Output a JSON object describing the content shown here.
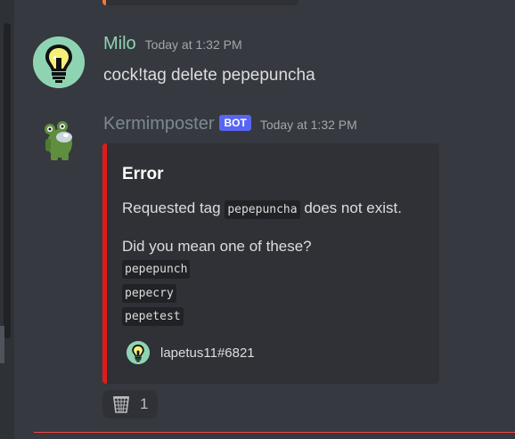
{
  "messages": [
    {
      "author": "Milo",
      "author_color": "#8fd4b2",
      "timestamp": "Today at 1:32 PM",
      "content": "cock!tag delete pepepuncha",
      "avatar_icon": "lightbulb-icon"
    },
    {
      "author": "Kermimposter",
      "author_color": "#7c8a90",
      "bot_tag": "BOT",
      "timestamp": "Today at 1:32 PM",
      "avatar_icon": "frog-crewmate-icon",
      "embed": {
        "accent": "#e01b1b",
        "title": "Error",
        "line1_prefix": "Requested tag ",
        "line1_code": "pepepuncha",
        "line1_suffix": " does not exist.",
        "line2": "Did you mean one of these?",
        "suggestions": [
          "pepepunch",
          "pepecry",
          "pepetest"
        ],
        "footer_text": "lapetus11#6821",
        "footer_icon": "lightbulb-icon"
      },
      "reaction": {
        "emoji": "wastebasket-icon",
        "count": "1"
      }
    }
  ],
  "colors": {
    "background": "#36393f",
    "embed_background": "#2f3136",
    "bot_tag": "#5865f2",
    "new_messages_divider": "#f04747"
  }
}
